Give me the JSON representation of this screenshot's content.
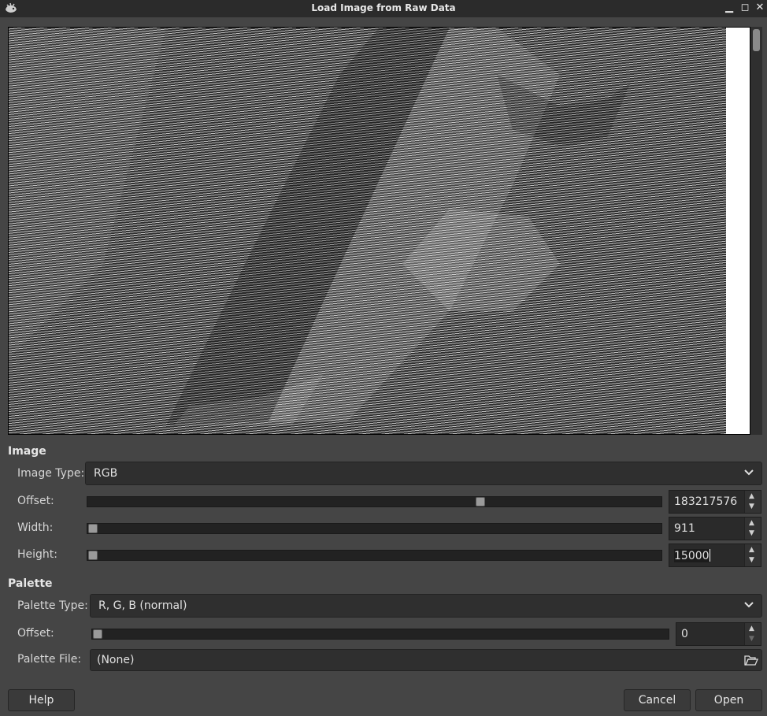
{
  "window": {
    "title": "Load Image from Raw Data",
    "icons": [
      "gimp-wilber-icon",
      "minimize-icon",
      "maximize-icon",
      "close-icon"
    ]
  },
  "image_section": {
    "heading": "Image",
    "image_type": {
      "label": "Image Type:",
      "value": "RGB"
    },
    "offset": {
      "label": "Offset:",
      "value": "183217576"
    },
    "width": {
      "label": "Width:",
      "value": "911"
    },
    "height": {
      "label": "Height:",
      "value": "15000"
    }
  },
  "palette_section": {
    "heading": "Palette",
    "palette_type": {
      "label": "Palette Type:",
      "value": "R, G, B (normal)"
    },
    "offset": {
      "label": "Offset:",
      "value": "0"
    },
    "palette_file": {
      "label": "Palette File:",
      "value": "(None)"
    }
  },
  "buttons": {
    "help": "Help",
    "cancel": "Cancel",
    "open": "Open"
  },
  "colors": {
    "background": "#454545",
    "titlebar": "#2b2b2b",
    "field": "#2f2f2f"
  }
}
